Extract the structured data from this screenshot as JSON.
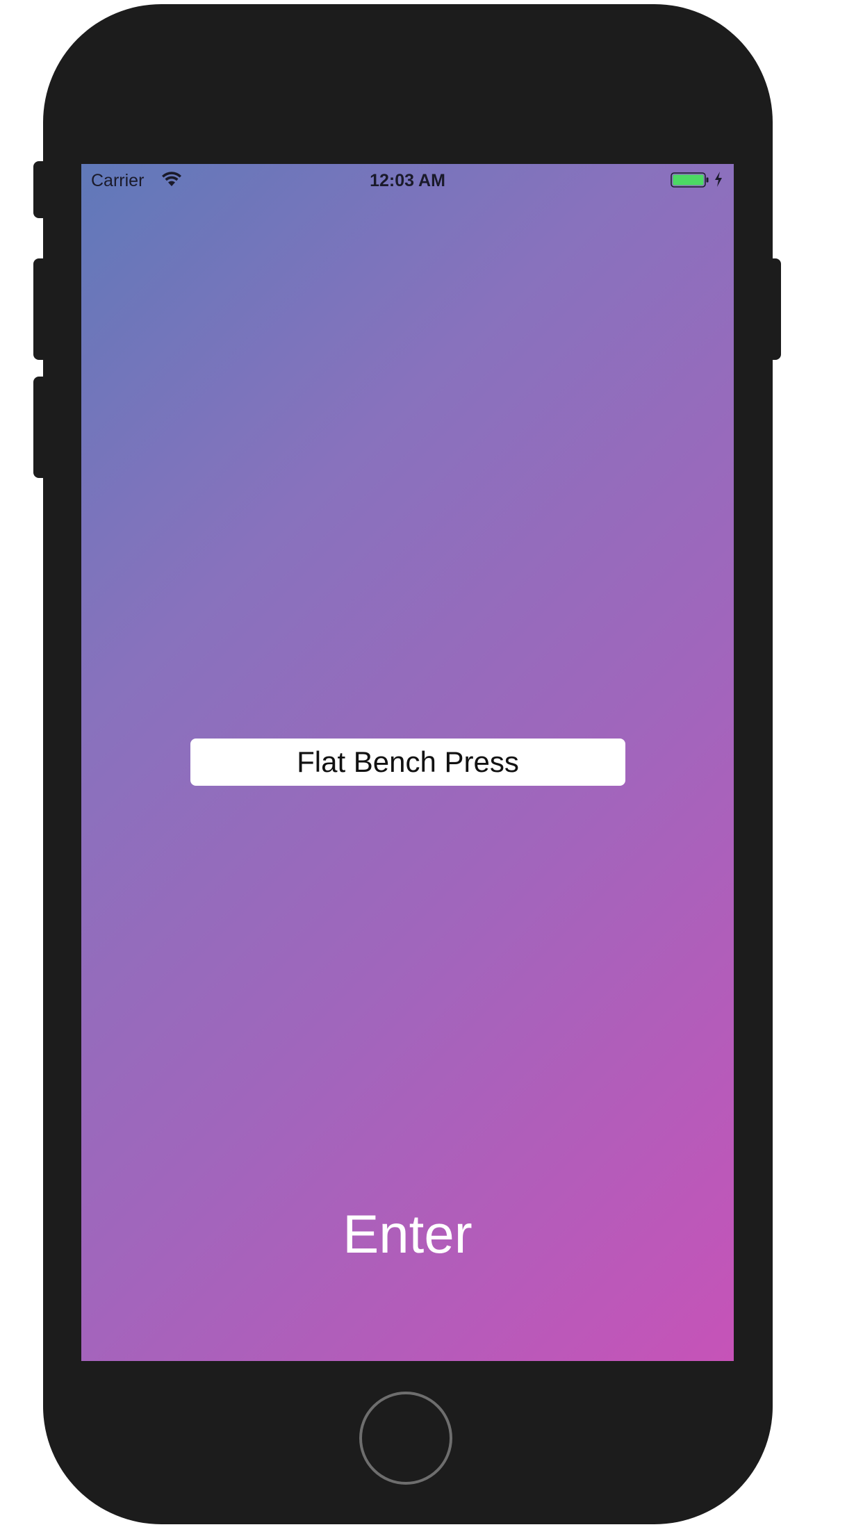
{
  "status_bar": {
    "carrier": "Carrier",
    "time": "12:03 AM",
    "wifi_icon": "wifi-icon",
    "battery_icon": "battery-full-icon",
    "charging_icon": "charging-bolt-icon",
    "battery_color": "#4cd964"
  },
  "exercise_input": {
    "value": "Flat Bench Press"
  },
  "enter_button": {
    "label": "Enter"
  },
  "colors": {
    "gradient_start": "#6079b9",
    "gradient_end": "#c653b8",
    "phone_body": "#1c1c1c"
  }
}
